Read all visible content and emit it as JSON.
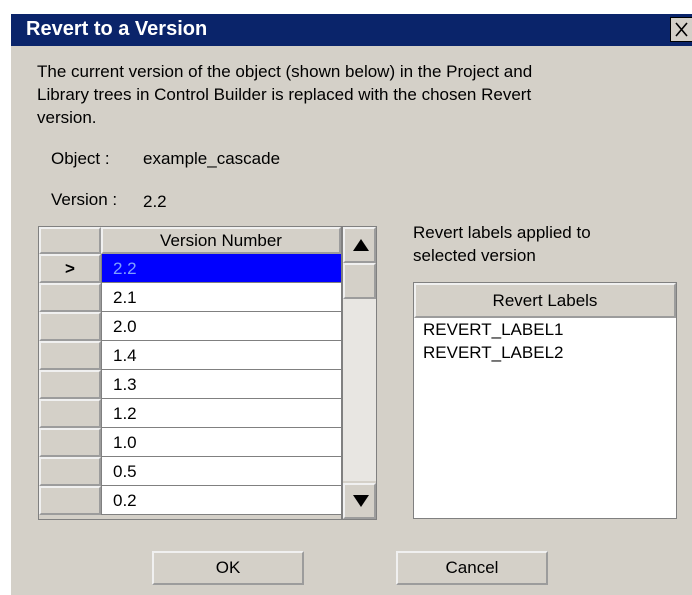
{
  "dialog": {
    "title": "Revert to a Version",
    "description_lines": [
      "The current version of the object (shown below) in the Project and",
      "Library trees in Control Builder is replaced with the chosen Revert",
      "version."
    ],
    "object_label": "Object :",
    "object_value": "example_cascade",
    "version_label": "Version :",
    "version_value": "2.2"
  },
  "versions_table": {
    "header": "Version Number",
    "selected_marker": ">",
    "rows": [
      "2.2",
      "2.1",
      "2.0",
      "1.4",
      "1.3",
      "1.2",
      "1.0",
      "0.5",
      "0.2"
    ],
    "selected_index": 0
  },
  "revert_panel": {
    "hint_lines": [
      "Revert labels applied to",
      "selected version"
    ],
    "header": "Revert Labels",
    "labels": [
      "REVERT_LABEL1",
      "REVERT_LABEL2"
    ]
  },
  "buttons": {
    "ok": "OK",
    "cancel": "Cancel"
  },
  "icons": {
    "close": "close-icon",
    "scroll_up": "arrow-up-icon",
    "scroll_down": "arrow-down-icon"
  },
  "colors": {
    "titlebar": "#0a246a",
    "selected_cell": "#0000ff",
    "dialog_face": "#d4d0c8"
  }
}
